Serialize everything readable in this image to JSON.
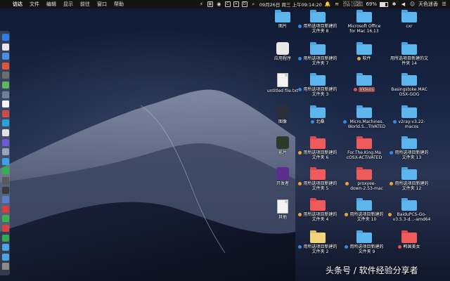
{
  "menubar": {
    "app_name": "访达",
    "items": [
      "文件",
      "编辑",
      "显示",
      "前往",
      "窗口",
      "帮助"
    ],
    "tray": {
      "netspeed_up": "0.0 KB/s",
      "netspeed_down": "0.0 KB/s",
      "netspeed_line1": "16°C  ↑27KB/s",
      "netspeed_line2": "1700 ↓18KB/s",
      "battery_percent": "69%",
      "battery_level": 0.69,
      "datetime": "09月26日 周三 上午09:14:20",
      "user": "天色迷香"
    }
  },
  "desktop": {
    "columns": [
      {
        "items": [
          {
            "label": "图片",
            "kind": "folder"
          },
          {
            "label": "应用程序",
            "kind": "app"
          },
          {
            "label": "untitled file.txt",
            "kind": "doc"
          },
          {
            "label": "图像",
            "kind": "app-dark"
          },
          {
            "label": "影片",
            "kind": "app-film"
          },
          {
            "label": "开发者",
            "kind": "app-purple"
          },
          {
            "label": "其他",
            "kind": "doc-zip"
          }
        ]
      },
      {
        "items": [
          {
            "label": "用所选项目新建的\n文件夹 8",
            "kind": "folder",
            "tag": "#3a86e0"
          },
          {
            "label": "用所选项目新建的\n文件夹 7",
            "kind": "folder",
            "tag": "#3a86e0"
          },
          {
            "label": "用所选项目新建的\n文件夹 3",
            "kind": "folder",
            "tag": "#3a86e0"
          },
          {
            "label": "北桑",
            "kind": "folder",
            "tag": "#3a86e0"
          },
          {
            "label": "用所选项目新建的\n文件夹 6",
            "kind": "folder-red",
            "tag": "#f0a23a"
          },
          {
            "label": "用所选项目新建的\n文件夹 5",
            "kind": "folder-red",
            "tag": "#f0a23a"
          },
          {
            "label": "用所选项目新建的\n文件夹 4",
            "kind": "folder-red",
            "tag": "#f0a23a"
          },
          {
            "label": "用所选项目新建的\n文件夹 2",
            "kind": "folder-yellow",
            "tag": "#3a86e0"
          }
        ]
      },
      {
        "items": [
          {
            "label": "Microsoft Office\nfor Mac 16.13",
            "kind": "folder"
          },
          {
            "label": "软件",
            "kind": "folder",
            "tag": "#f0a23a"
          },
          {
            "label": "Videos",
            "kind": "folder-videos",
            "tag": "#e0554a",
            "selected": true
          },
          {
            "label": "Micro.Machines.\nWorld.S...TIVATED",
            "kind": "folder",
            "tag": "#3a86e0"
          },
          {
            "label": "For.The.King.Ma\ncOSX-ACTiVATED",
            "kind": "folder-red"
          },
          {
            "label": "proxyee-\ndown-2.53-mac",
            "kind": "folder-red",
            "tag": "#f0a23a"
          },
          {
            "label": "用所选项目新建的\n文件夹 10",
            "kind": "folder",
            "tag": "#f0a23a"
          },
          {
            "label": "用所选项目新建的\n文件夹 9",
            "kind": "folder",
            "tag": "#3a86e0"
          }
        ]
      },
      {
        "items": [
          {
            "label": "cxr",
            "kind": "folder"
          },
          {
            "label": "用所选项目新建的文\n件夹 14",
            "kind": "folder"
          },
          {
            "label": "Basingstoke.MAC\nOSX-GOG",
            "kind": "folder"
          },
          {
            "label": "v2ray-v3.22-\nmacos",
            "kind": "folder",
            "tag": "#3a86e0"
          },
          {
            "label": "用所选项目新建的\n文件夹 13",
            "kind": "folder",
            "tag": "#3a86e0"
          },
          {
            "label": "用所选项目新建的\n文件夹 12",
            "kind": "folder",
            "tag": "#f0a23a"
          },
          {
            "label": "BaiduPCS-Go-\nv3.5.3-d...-amd64",
            "kind": "folder",
            "tag": "#f0a23a"
          },
          {
            "label": "韩国美女",
            "kind": "folder-red",
            "tag": "#e0554a"
          }
        ]
      }
    ]
  },
  "watermark": "头条号 / 软件经验分享者"
}
